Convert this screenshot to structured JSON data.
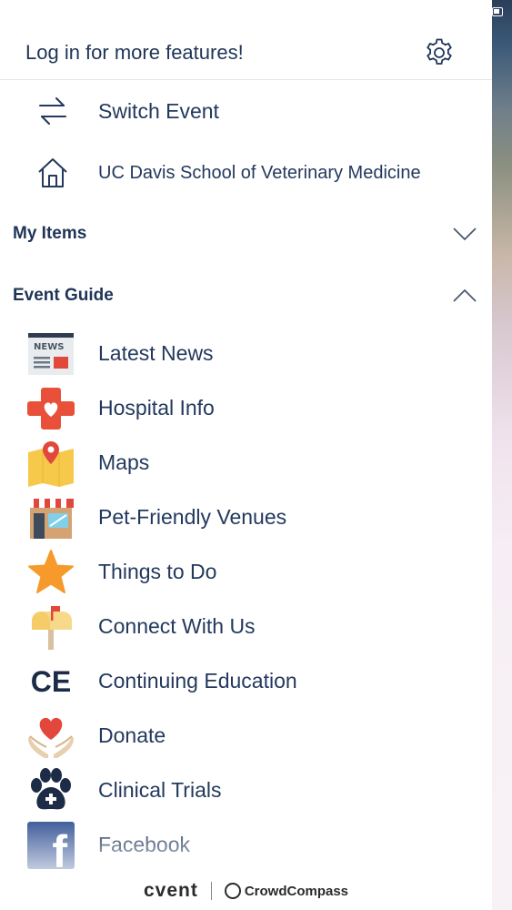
{
  "header": {
    "title": "Log in for more features!",
    "settings_icon": "gear-icon"
  },
  "nav": {
    "switch_event": {
      "label": "Switch Event",
      "icon": "swap-arrows-icon"
    },
    "home": {
      "label": "UC Davis School of Veterinary Medicine",
      "icon": "home-icon"
    }
  },
  "sections": {
    "my_items": {
      "title": "My Items",
      "state": "collapsed"
    },
    "event_guide": {
      "title": "Event Guide",
      "state": "expanded"
    }
  },
  "guide_items": [
    {
      "label": "Latest News",
      "icon": "newspaper-icon"
    },
    {
      "label": "Hospital Info",
      "icon": "medical-cross-icon"
    },
    {
      "label": "Maps",
      "icon": "map-pin-icon"
    },
    {
      "label": "Pet-Friendly Venues",
      "icon": "storefront-icon"
    },
    {
      "label": "Things to Do",
      "icon": "star-icon"
    },
    {
      "label": "Connect With Us",
      "icon": "mailbox-icon"
    },
    {
      "label": "Continuing Education",
      "icon": "ce-text-icon",
      "icon_text": "CE"
    },
    {
      "label": "Donate",
      "icon": "heart-hands-icon"
    },
    {
      "label": "Clinical Trials",
      "icon": "paw-icon"
    },
    {
      "label": "Facebook",
      "icon": "facebook-icon",
      "icon_text": "f"
    }
  ],
  "footer": {
    "brand1": "cvent",
    "brand2": "CrowdCompass"
  },
  "colors": {
    "text": "#23395d",
    "accent_orange": "#f08a24",
    "accent_red": "#e2473b",
    "divider": "#e3e6ea"
  }
}
